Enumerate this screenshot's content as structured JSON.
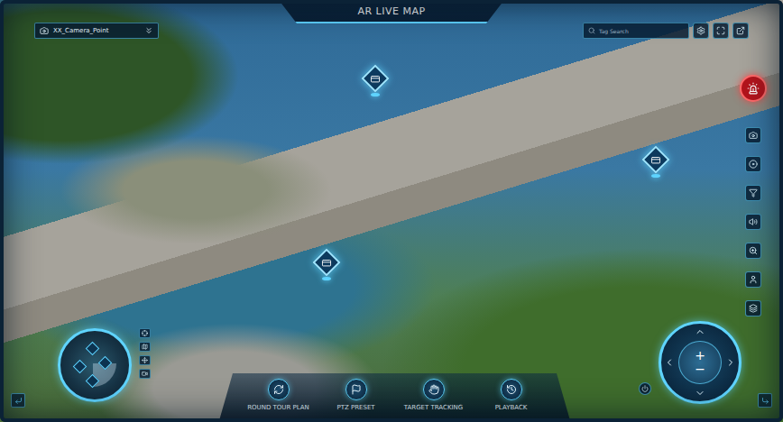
{
  "header": {
    "title": "AR LIVE MAP"
  },
  "camera_select": {
    "value": "XX_Camera_Point"
  },
  "search": {
    "placeholder": "Tag Search"
  },
  "pins": [
    {
      "kind": "camera"
    },
    {
      "kind": "camera"
    },
    {
      "kind": "camera"
    }
  ],
  "alarm": {
    "active": true
  },
  "toolbar": [
    {
      "label": "ROUND TOUR PLAN"
    },
    {
      "label": "PTZ PRESET"
    },
    {
      "label": "TARGET TRACKING"
    },
    {
      "label": "PLAYBACK"
    }
  ],
  "ptz": {
    "zoom_in": "+",
    "zoom_out": "−"
  }
}
